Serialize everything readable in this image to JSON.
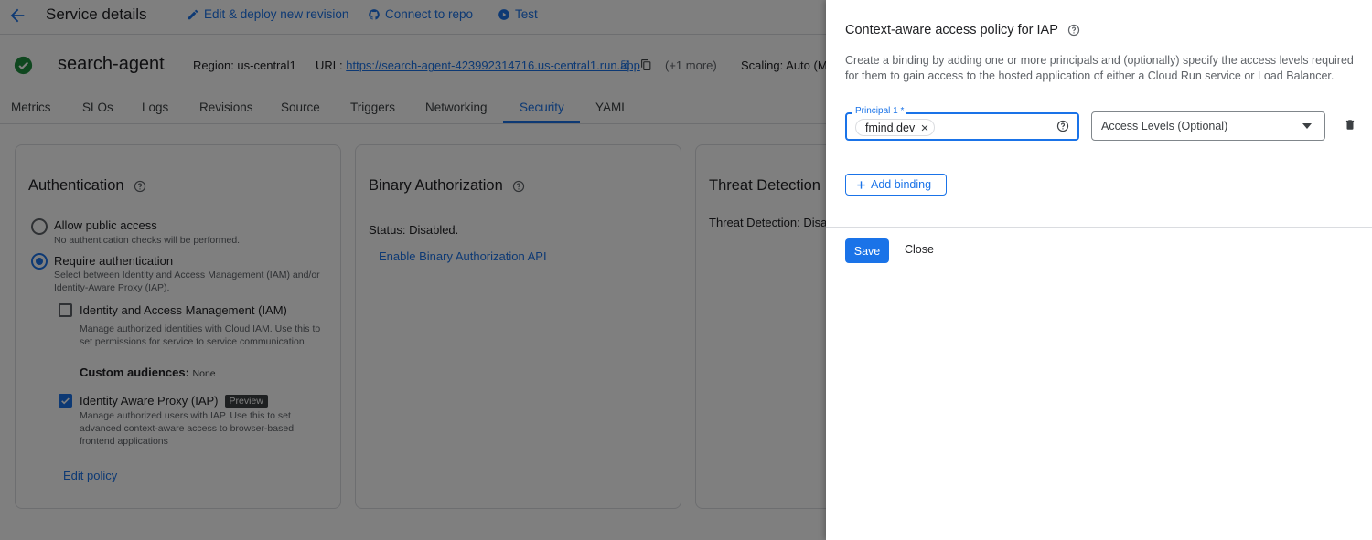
{
  "header": {
    "title": "Service details",
    "actions": [
      {
        "label": "Edit & deploy new revision",
        "icon": "pencil-icon"
      },
      {
        "label": "Connect to repo",
        "icon": "github-icon"
      },
      {
        "label": "Test",
        "icon": "play-circle-icon"
      }
    ]
  },
  "service": {
    "name": "search-agent",
    "status_icon": "check-circle-icon",
    "region": "Region: us-central1",
    "url_label": "URL: ",
    "url": "https://search-agent-423992314716.us-central1.run.app",
    "more": "(+1 more)",
    "scaling": "Scaling: Auto (Mi"
  },
  "tabs": [
    "Metrics",
    "SLOs",
    "Logs",
    "Revisions",
    "Source",
    "Triggers",
    "Networking",
    "Security",
    "YAML"
  ],
  "active_tab": "Security",
  "auth_card": {
    "title": "Authentication",
    "allow_public_label": "Allow public access",
    "allow_public_desc": "No authentication checks will be performed.",
    "require_auth_label": "Require authentication",
    "require_auth_desc": "Select between Identity and Access Management (IAM) and/or Identity-Aware Proxy (IAP).",
    "iam_label": "Identity and Access Management (IAM)",
    "iam_desc": "Manage authorized identities with Cloud IAM. Use this to set permissions for service to service communication",
    "custom_audiences_label": "Custom audiences:",
    "custom_audiences_value": "None",
    "iap_label": "Identity Aware Proxy (IAP)",
    "iap_badge": "Preview",
    "iap_desc": "Manage authorized users with IAP. Use this to set advanced context-aware access to browser-based frontend applications",
    "edit_policy": "Edit policy"
  },
  "binary_card": {
    "title": "Binary Authorization",
    "status": "Status: Disabled.",
    "enable_link": "Enable Binary Authorization API"
  },
  "threat_card": {
    "title": "Threat Detection",
    "status": "Threat Detection: Disab"
  },
  "panel": {
    "title": "Context-aware access policy for IAP",
    "description": "Create a binding by adding one or more principals and (optionally) specify the access levels required for them to gain access to the hosted application of either a Cloud Run service or Load Balancer.",
    "principal_label": "Principal 1 *",
    "principal_chip": "fmind.dev",
    "access_levels_placeholder": "Access Levels (Optional)",
    "add_binding": "Add binding",
    "save": "Save",
    "close": "Close"
  },
  "colors": {
    "accent": "#1a73e8",
    "success": "#1e8e3e",
    "scrim": "rgba(0,0,0,0.5)"
  }
}
